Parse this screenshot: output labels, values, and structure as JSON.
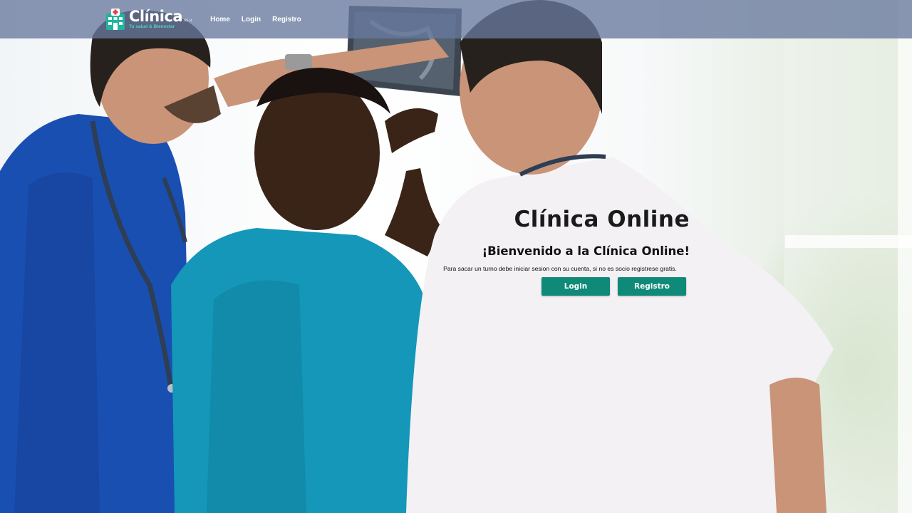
{
  "navbar": {
    "brand": {
      "name": "Clínica",
      "suffix": "ss.a",
      "tagline": "Tu salud & Bienestar",
      "icon": "hospital-icon"
    },
    "links": [
      {
        "label": "Home"
      },
      {
        "label": "Login"
      },
      {
        "label": "Registro"
      }
    ]
  },
  "hero": {
    "title": "Clínica Online",
    "subtitle": "¡Bienvenido a la Clínica Online!",
    "text": "Para sacar un turno debe iniciar sesion con su cuenta, si no es socio registrese gratis.",
    "buttons": {
      "login": "Login",
      "register": "Registro"
    },
    "image": "doctors-reviewing-xray-photo"
  },
  "colors": {
    "navbar": "#68789e",
    "brand_accent": "#4fd3c3",
    "button": "#0f8a78",
    "text": "#111111"
  }
}
